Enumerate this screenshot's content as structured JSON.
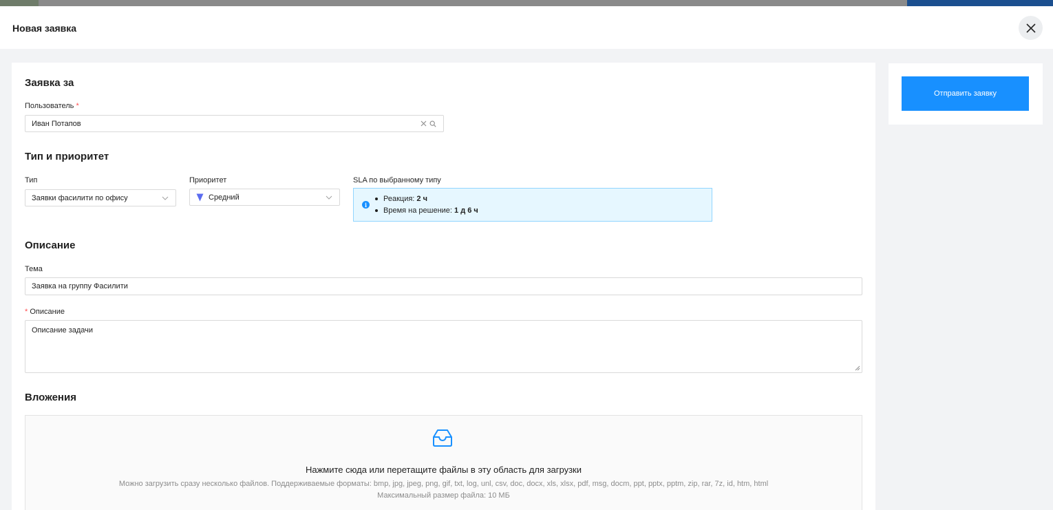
{
  "modal": {
    "title": "Новая заявка"
  },
  "form": {
    "section_requester": "Заявка за",
    "user_label": "Пользователь",
    "user_required_mark": "*",
    "user_value": "Иван Потапов",
    "section_type": "Тип и приоритет",
    "type_label": "Тип",
    "type_value": "Заявки фасилити по офису",
    "priority_label": "Приоритет",
    "priority_value": "Средний",
    "sla_label": "SLA по выбранному типу",
    "sla_reaction_label": "Реакция:",
    "sla_reaction_value": "2 ч",
    "sla_resolution_label": "Время на решение:",
    "sla_resolution_value": "1 д 6 ч",
    "section_description": "Описание",
    "subject_label": "Тема",
    "subject_value": "Заявка на группу Фасилити",
    "description_required_mark": "*",
    "description_label": "Описание",
    "description_value": "Описание задачи",
    "section_attachments": "Вложения",
    "dropzone_text": "Нажмите сюда или перетащите файлы в эту область для загрузки",
    "dropzone_hint": "Можно загрузить сразу несколько файлов. Поддерживаемые форматы: bmp, jpg, jpeg, png, gif, txt, log, unl, csv, doc, docx, xls, xlsx, pdf, msg, docm, ppt, pptx, pptm, zip, rar, 7z, id, htm, html",
    "dropzone_max_size": "Максимальный размер файла: 10 МБ"
  },
  "sidebar": {
    "submit_label": "Отправить заявку"
  },
  "colors": {
    "primary": "#1890ff",
    "required": "#ff4d4f",
    "priority_medium": "#5b6cf0",
    "sla_background": "#e6f7ff"
  },
  "icons": {
    "close": "close-icon",
    "clear": "clear-icon",
    "search": "search-icon",
    "chevron": "chevron-down-icon",
    "priority": "priority-triangle-icon",
    "info": "info-icon",
    "upload": "inbox-icon"
  }
}
